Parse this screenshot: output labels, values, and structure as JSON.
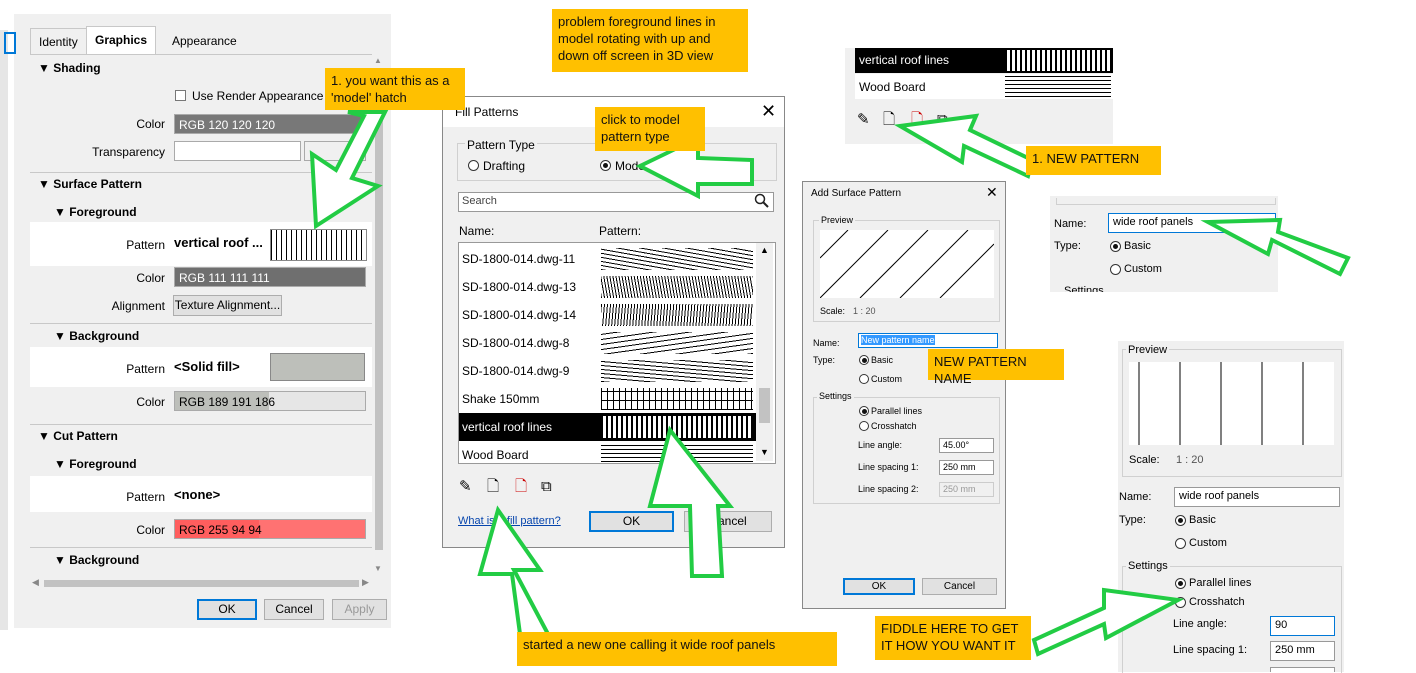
{
  "notes": {
    "model_hatch": "1. you want this as a 'model' hatch",
    "problem": "problem foreground lines in model rotating with up and down off screen in 3D view",
    "click_model": "click to model pattern type",
    "new_pattern": "1. NEW PATTERN",
    "new_pattern_name": "NEW PATTERN NAME",
    "started_new": "started a new one calling it wide roof panels",
    "fiddle": "FIDDLE HERE TO GET IT HOW YOU WANT IT"
  },
  "properties": {
    "tabs": [
      "Identity",
      "Graphics",
      "Appearance"
    ],
    "active_tab": "Graphics",
    "shading": {
      "heading": "Shading",
      "use_render_label": "Use Render Appearance",
      "color_label": "Color",
      "color_value": "RGB 120 120 120",
      "transparency_label": "Transparency"
    },
    "surface": {
      "heading": "Surface Pattern",
      "foreground": "Foreground",
      "pattern_label": "Pattern",
      "fg_pattern": "vertical roof ...",
      "color_label": "Color",
      "fg_color": "RGB 111 111 111",
      "alignment_label": "Alignment",
      "alignment_button": "Texture Alignment...",
      "background": "Background",
      "bg_pattern": "<Solid fill>",
      "bg_color": "RGB 189 191 186"
    },
    "cut": {
      "heading": "Cut Pattern",
      "foreground": "Foreground",
      "pattern_label": "Pattern",
      "fg_pattern": "<none>",
      "color_label": "Color",
      "fg_color": "RGB 255 94 94",
      "background": "Background"
    },
    "buttons": {
      "ok": "OK",
      "cancel": "Cancel",
      "apply": "Apply"
    },
    "colors": {
      "shading": "#787878",
      "fg": "#6f6f6f",
      "bg": "#bdbfba",
      "cut": "#ff5e5e"
    }
  },
  "fill_patterns": {
    "title": "Fill Patterns",
    "pattern_type_label": "Pattern Type",
    "drafting": "Drafting",
    "model": "Model",
    "search_placeholder": "Search",
    "col_name": "Name:",
    "col_pattern": "Pattern:",
    "items": [
      "SD-1800-014.dwg-11",
      "SD-1800-014.dwg-13",
      "SD-1800-014.dwg-14",
      "SD-1800-014.dwg-8",
      "SD-1800-014.dwg-9",
      "Shake 150mm",
      "vertical roof lines",
      "Wood Board"
    ],
    "selected": "vertical roof lines",
    "help_link": "What is a fill pattern?",
    "ok": "OK",
    "cancel": "Cancel"
  },
  "mini_list": {
    "items": [
      "vertical roof lines",
      "Wood Board"
    ]
  },
  "add_surface": {
    "title": "Add Surface Pattern",
    "preview_label": "Preview",
    "scale_label": "Scale:",
    "scale_value": "1 : 20",
    "name_label": "Name:",
    "name_value": "New pattern name",
    "type_label": "Type:",
    "basic": "Basic",
    "custom": "Custom",
    "settings_label": "Settings",
    "parallel": "Parallel lines",
    "crosshatch": "Crosshatch",
    "line_angle_label": "Line angle:",
    "line_angle_value": "45.00°",
    "spacing1_label": "Line spacing 1:",
    "spacing1_value": "250 mm",
    "spacing2_label": "Line spacing 2:",
    "spacing2_value": "250 mm",
    "ok": "OK",
    "cancel": "Cancel"
  },
  "name_crop": {
    "name_label": "Name:",
    "name_value": "wide roof panels",
    "type_label": "Type:",
    "basic": "Basic",
    "custom": "Custom",
    "settings_partial": "Settings"
  },
  "final": {
    "preview_label": "Preview",
    "scale_label": "Scale:",
    "scale_value": "1 : 20",
    "name_label": "Name:",
    "name_value": "wide roof panels",
    "type_label": "Type:",
    "basic": "Basic",
    "custom": "Custom",
    "settings_label": "Settings",
    "parallel": "Parallel lines",
    "crosshatch": "Crosshatch",
    "line_angle_label": "Line angle:",
    "line_angle_value": "90",
    "spacing1_label": "Line spacing 1:",
    "spacing1_value": "250 mm"
  }
}
